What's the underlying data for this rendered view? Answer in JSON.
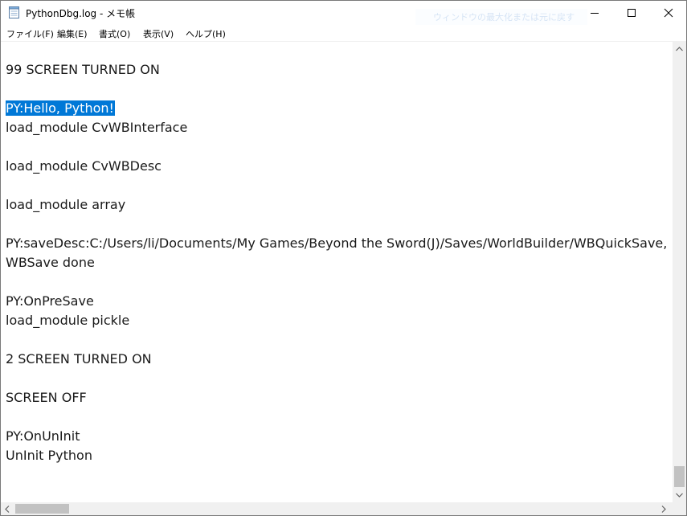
{
  "window": {
    "title": "PythonDbg.log - メモ帳",
    "ghost_text": "ウィンドウの最大化または元に戻す"
  },
  "menu": {
    "items": [
      {
        "label": "ファイル(F)"
      },
      {
        "label": "編集(E)"
      },
      {
        "label": "書式(O)"
      },
      {
        "label": "表示(V)"
      },
      {
        "label": "ヘルプ(H)"
      }
    ]
  },
  "editor": {
    "lines": [
      "99 SCREEN TURNED ON",
      "",
      "PY:Hello, Python!",
      "load_module CvWBInterface",
      "",
      "load_module CvWBDesc",
      "",
      "load_module array",
      "",
      "PY:saveDesc:C:/Users/li/Documents/My Games/Beyond the Sword(J)/Saves/WorldBuilder/WBQuickSave,",
      "WBSave done",
      "",
      "PY:OnPreSave",
      "load_module pickle",
      "",
      "2 SCREEN TURNED ON",
      "",
      "SCREEN OFF",
      "",
      "PY:OnUnInit",
      "UnInit Python"
    ],
    "selected_text": "PY:Hello, Python!"
  },
  "icons": {
    "app": "notepad-icon",
    "minimize": "minimize-icon",
    "maximize": "maximize-icon",
    "close": "close-icon"
  },
  "colors": {
    "selection": "#0078d7",
    "scrollbar_track": "#f0f0f0",
    "scrollbar_thumb": "#c2c2c2"
  }
}
